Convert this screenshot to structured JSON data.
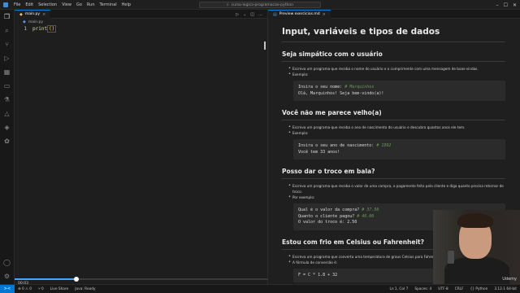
{
  "titlebar": {
    "menu": [
      "File",
      "Edit",
      "Selection",
      "View",
      "Go",
      "Run",
      "Terminal",
      "Help"
    ],
    "search": "curso-logica-programacao-python"
  },
  "activity": {
    "icons": [
      "files-icon",
      "search-icon",
      "source-control-icon",
      "run-debug-icon",
      "extensions-icon",
      "remote-icon",
      "testing-icon",
      "flask-icon",
      "docker-icon",
      "python-icon"
    ],
    "bottom_icons": [
      "account-icon",
      "settings-icon"
    ]
  },
  "editor": {
    "tab_label": "main.py",
    "breadcrumb_file": "main.py",
    "line_number": "1",
    "code_fn": "print",
    "code_parens": "()"
  },
  "preview": {
    "tab_label": "Preview exercicios.md",
    "title": "Input, variáveis e tipos de dados",
    "sections": [
      {
        "heading": "Seja simpático com o usuário",
        "bullet1": "Escreva um programa que receba o nome do usuário e o cumprimente com uma mensagem de boas-vindas.",
        "bullet2": "Exemplo:",
        "code_line1_prefix": "Insira o seu nome: ",
        "code_line1_comment": "# Marquinhos",
        "code_line2": "Olá, Marquinhos! Seja bem-vindo(a)!"
      },
      {
        "heading": "Você não me parece velho(a)",
        "bullet1": "Escreva um programa que receba o ano de nascimento do usuário e descubra quantos anos ele tem.",
        "bullet2": "Exemplo:",
        "code_line1_prefix": "Insira o seu ano de nascimento: ",
        "code_line1_comment": "# 1992",
        "code_line2": "Você tem 33 anos!"
      },
      {
        "heading": "Posso dar o troco em bala?",
        "bullet1": "Escreva um programa que receba o valor de uma compra, o pagamento feito pelo cliente e diga quanto precisa retornar de troco.",
        "bullet2": "Por exemplo:",
        "code_line1_prefix": "Qual é o valor da compra? ",
        "code_line1_comment": "# 37.50",
        "code_line2_prefix": "Quanto o cliente pagou? ",
        "code_line2_comment": "# 40.00",
        "code_line3": "O valor do troco é: 2.50"
      },
      {
        "heading": "Estou com frio em Celsius ou Fahrenheit?",
        "bullet1": "Escreva um programa que converta uma temperatura de graus Celsius para Fahrenheit.",
        "bullet2": "A fórmula de conversão é:",
        "code_line1": "F = C * 1.8 + 32"
      }
    ]
  },
  "video": {
    "progress_fraction": 0.23,
    "time": "00:03"
  },
  "statusbar": {
    "remote": "><",
    "left": [
      "⊗ 0 ⚠ 0",
      "⑂ 0",
      "Live Share",
      "Java: Ready"
    ],
    "right": [
      "Ln 1, Col 7",
      "Spaces: 4",
      "UTF-8",
      "CRLF",
      "{} Python",
      "3.12.1 64-bit"
    ]
  },
  "webcam": {
    "logo": "Udemy"
  },
  "colors": {
    "accent": "#0078d4",
    "comment": "#6a9955",
    "progress": "#4aa3ff"
  }
}
